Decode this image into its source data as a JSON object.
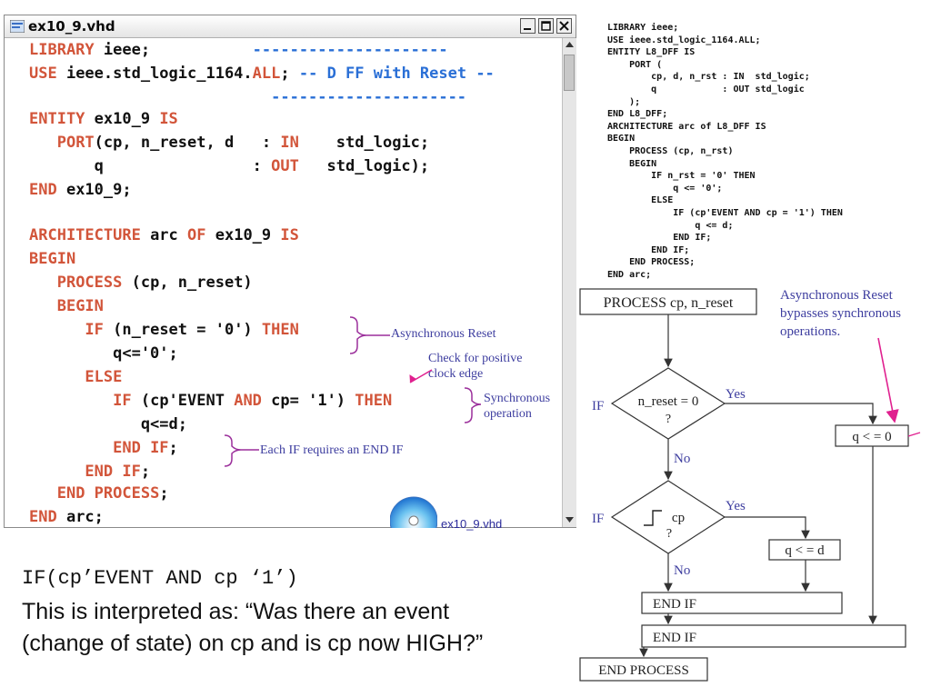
{
  "window": {
    "title": "ex10_9.vhd"
  },
  "code_lines": [
    [
      {
        "t": "LIBRARY",
        "k": 1
      },
      {
        "t": " ieee;"
      },
      {
        "t": "           ---------------------",
        "d": 1
      }
    ],
    [
      {
        "t": "USE",
        "k": 1
      },
      {
        "t": " ieee.std_logic_1164."
      },
      {
        "t": "ALL",
        "k": 1
      },
      {
        "t": "; "
      },
      {
        "t": "-- D FF with Reset --",
        "d": 1
      }
    ],
    [
      {
        "t": "                          ---------------------",
        "d": 1
      }
    ],
    [
      {
        "t": ""
      }
    ],
    [
      {
        "t": "ENTITY",
        "k": 1
      },
      {
        "t": " ex10_9 "
      },
      {
        "t": "IS",
        "k": 1
      }
    ],
    [
      {
        "t": "   "
      },
      {
        "t": "PORT",
        "k": 1
      },
      {
        "t": "(cp, n_reset, d   : "
      },
      {
        "t": "IN",
        "k": 1
      },
      {
        "t": "    std_logic;"
      }
    ],
    [
      {
        "t": "       q                : "
      },
      {
        "t": "OUT",
        "k": 1
      },
      {
        "t": "   std_logic);"
      }
    ],
    [
      {
        "t": "END",
        "k": 1
      },
      {
        "t": " ex10_9;"
      }
    ],
    [
      {
        "t": ""
      }
    ],
    [
      {
        "t": "ARCHITECTURE",
        "k": 1
      },
      {
        "t": " arc "
      },
      {
        "t": "OF",
        "k": 1
      },
      {
        "t": " ex10_9 "
      },
      {
        "t": "IS",
        "k": 1
      }
    ],
    [
      {
        "t": "BEGIN",
        "k": 1
      }
    ],
    [
      {
        "t": "   "
      },
      {
        "t": "PROCESS",
        "k": 1
      },
      {
        "t": " (cp, n_reset)"
      }
    ],
    [
      {
        "t": "   "
      },
      {
        "t": "BEGIN",
        "k": 1
      }
    ],
    [
      {
        "t": "      "
      },
      {
        "t": "IF",
        "k": 1
      },
      {
        "t": " (n_reset = '0') "
      },
      {
        "t": "THEN",
        "k": 1
      }
    ],
    [
      {
        "t": "         q<='0';"
      }
    ],
    [
      {
        "t": "      "
      },
      {
        "t": "ELSE",
        "k": 1
      }
    ],
    [
      {
        "t": "         "
      },
      {
        "t": "IF",
        "k": 1
      },
      {
        "t": " (cp'EVENT "
      },
      {
        "t": "AND",
        "k": 1
      },
      {
        "t": " cp= '1') "
      },
      {
        "t": "THEN",
        "k": 1
      }
    ],
    [
      {
        "t": "            q<=d;"
      }
    ],
    [
      {
        "t": "         "
      },
      {
        "t": "END IF",
        "k": 1
      },
      {
        "t": ";"
      }
    ],
    [
      {
        "t": "      "
      },
      {
        "t": "END IF",
        "k": 1
      },
      {
        "t": ";"
      }
    ],
    [
      {
        "t": "   "
      },
      {
        "t": "END PROCESS",
        "k": 1
      },
      {
        "t": ";"
      }
    ],
    [
      {
        "t": "END",
        "k": 1
      },
      {
        "t": " arc;"
      }
    ]
  ],
  "annotations": {
    "async_reset": "Asynchronous Reset",
    "check_edge": "Check for positive\nclock edge",
    "sync_op": "Synchronous\noperation",
    "end_if": "Each IF requires an END IF"
  },
  "file_label": "ex10_9.vhd",
  "right_code": "LIBRARY ieee;\nUSE ieee.std_logic_1164.ALL;\nENTITY L8_DFF IS\n    PORT (\n        cp, d, n_rst : IN  std_logic;\n        q            : OUT std_logic\n    );\nEND L8_DFF;\nARCHITECTURE arc of L8_DFF IS\nBEGIN\n    PROCESS (cp, n_rst)\n    BEGIN\n        IF n_rst = '0' THEN\n            q <= '0';\n        ELSE\n            IF (cp'EVENT AND cp = '1') THEN\n                q <= d;\n            END IF;\n        END IF;\n    END PROCESS;\nEND arc;",
  "flowchart": {
    "process": "PROCESS cp, n_reset",
    "note": [
      "Asynchronous Reset",
      "bypasses synchronous",
      "operations."
    ],
    "if1_label": "IF",
    "cond1": [
      "n_reset = 0",
      "?"
    ],
    "yes1": "Yes",
    "no1": "No",
    "q0": "q < = 0",
    "if2_label": "IF",
    "cond2": [
      "cp",
      "?"
    ],
    "yes2": "Yes",
    "no2": "No",
    "qd": "q < = d",
    "endif_inner": "END IF",
    "endif_outer": "END IF",
    "end_process": "END PROCESS"
  },
  "bottom": {
    "code": "IF(cp’EVENT AND cp ‘1’)",
    "text": "This is interpreted as: “Was there an event (change of state) on cp and is cp now HIGH?”"
  },
  "colors": {
    "keyword": "#d2553a",
    "comment_dash": "#2a6fd6",
    "annotation": "#3d3d9f",
    "brace": "#9b2f9b",
    "arrow_magenta": "#e0208f"
  }
}
